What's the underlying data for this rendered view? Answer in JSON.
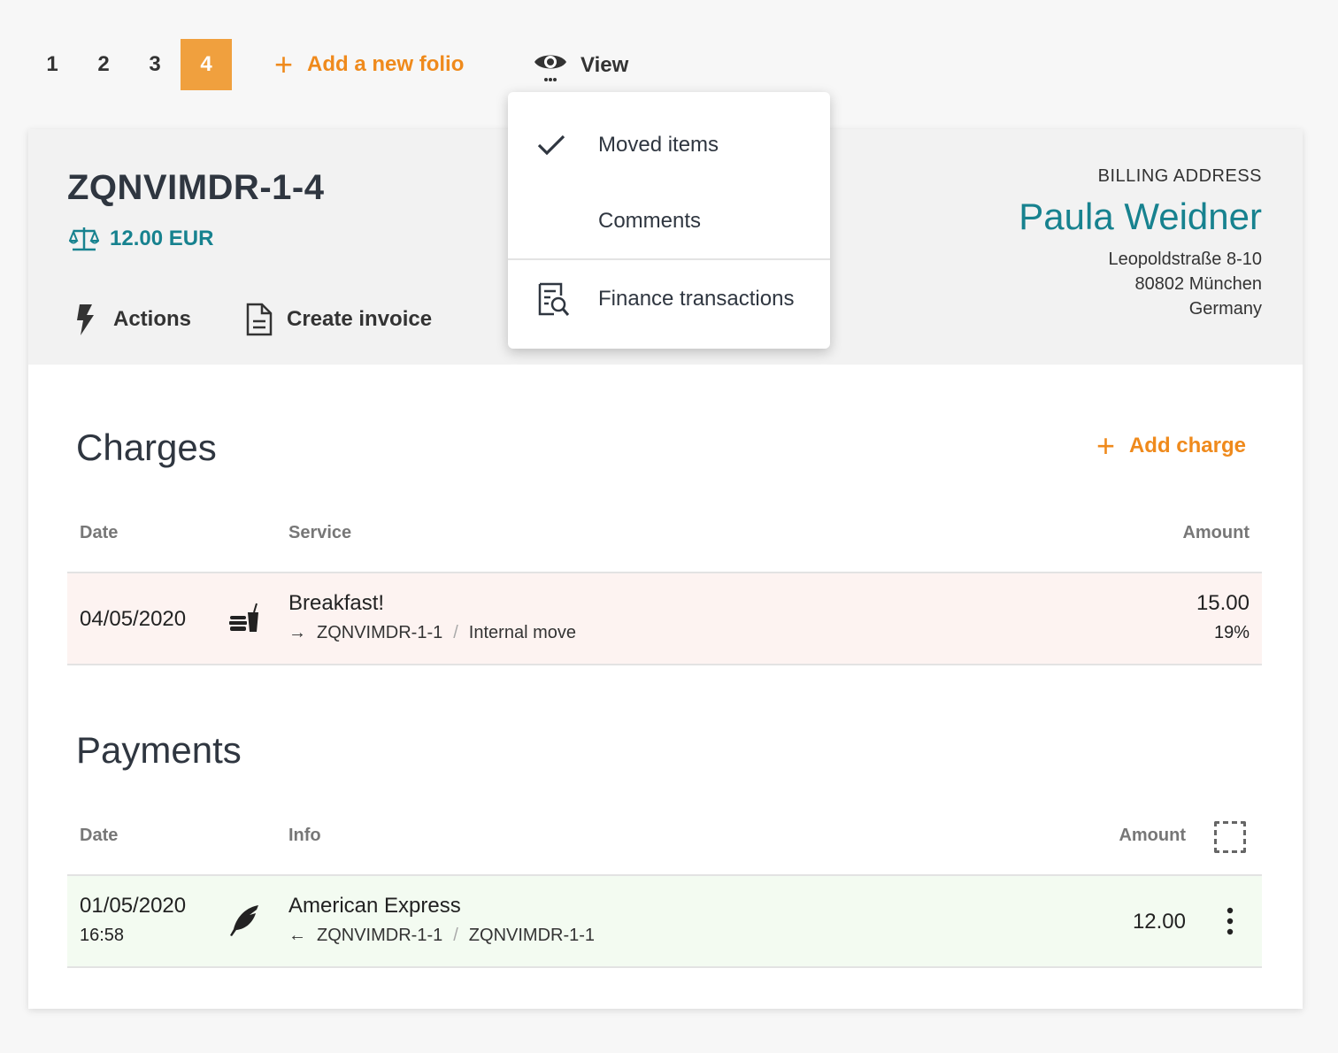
{
  "folio_tabs": [
    "1",
    "2",
    "3",
    "4"
  ],
  "add_folio_label": "Add a new folio",
  "view_label": "View",
  "view_menu": {
    "moved_items": "Moved items",
    "comments": "Comments",
    "finance_transactions": "Finance transactions"
  },
  "folio": {
    "title": "ZQNVIMDR-1-4",
    "balance": "12.00 EUR",
    "actions_label": "Actions",
    "create_invoice_label": "Create invoice"
  },
  "billing": {
    "label": "BILLING ADDRESS",
    "name": "Paula Weidner",
    "street": "Leopoldstraße 8-10",
    "city": "80802 München",
    "country": "Germany"
  },
  "charges": {
    "title": "Charges",
    "add_label": "Add charge",
    "headers": {
      "date": "Date",
      "service": "Service",
      "amount": "Amount"
    },
    "row": {
      "date": "04/05/2020",
      "service": "Breakfast!",
      "target": "ZQNVIMDR-1-1",
      "move_type": "Internal move",
      "amount": "15.00",
      "vat": "19%"
    }
  },
  "payments": {
    "title": "Payments",
    "headers": {
      "date": "Date",
      "info": "Info",
      "amount": "Amount"
    },
    "row": {
      "date": "01/05/2020",
      "time": "16:58",
      "method": "American Express",
      "source": "ZQNVIMDR-1-1",
      "target": "ZQNVIMDR-1-1",
      "amount": "12.00"
    }
  },
  "colors": {
    "accent": "#f0a03e",
    "teal": "#17828f",
    "orange_text": "#ef8a1c"
  }
}
